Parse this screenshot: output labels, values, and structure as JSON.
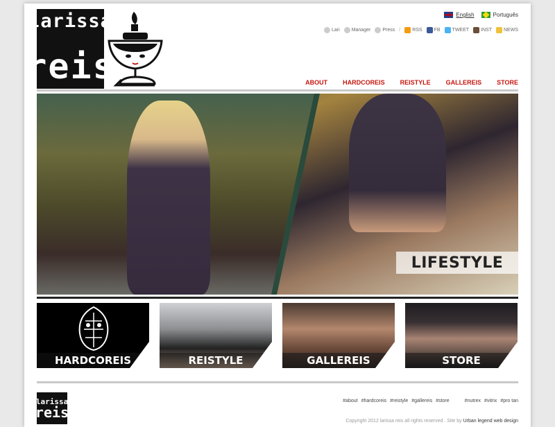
{
  "brand": {
    "logo_line1": "larissa",
    "logo_line2": "reis"
  },
  "languages": [
    {
      "label": "English",
      "flag": "uk-flag-icon"
    },
    {
      "label": "Português",
      "flag": "brazil-flag-icon"
    }
  ],
  "utility_links": {
    "lari": "Lari",
    "manager": "Manager",
    "press": "Press",
    "rss": "RSS",
    "fb": "FB",
    "tweet": "TWEET",
    "inst": "INST",
    "news": "NEWS"
  },
  "main_nav": [
    "ABOUT",
    "HARDCOREIS",
    "REISTYLE",
    "GALLEREIS",
    "STORE"
  ],
  "hero": {
    "label": "LIFESTYLE"
  },
  "tiles": [
    "HARDCOREIS",
    "REISTYLE",
    "GALLEREIS",
    "STORE"
  ],
  "footer": {
    "tags": [
      "#about",
      "#hardcoreis",
      "#reistyle",
      "#gallereis",
      "#store"
    ],
    "partner_tags": [
      "#nutrex",
      "#vitrix",
      "#pro tan"
    ],
    "copyright": "Copyright 2012 larissa reis all rights reserved . Site by",
    "credit": "Urban legend web design"
  },
  "colors": {
    "accent": "#c4160f",
    "divider_dark": "#222222",
    "divider_light": "#c8c8c8"
  }
}
